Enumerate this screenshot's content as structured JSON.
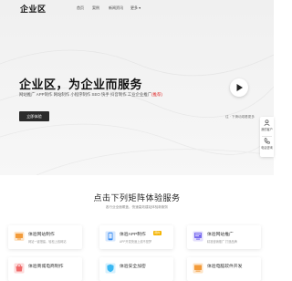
{
  "header": {
    "logo": "企业区",
    "nav": [
      "首页",
      "案例",
      "新闻资讯",
      "更多 ▾"
    ]
  },
  "hero": {
    "title": "企业区，为企业而服务",
    "subtitle_main": "网站推广 APP制作 网站制作 小程序制作 SEO 快手 抖音制作 工业企业推广",
    "subtitle_highlight": "(推荐)",
    "button": "立即体验",
    "hint": "往 · 下滑动观看更多"
  },
  "float_panel": {
    "items": [
      {
        "icon": "user-icon",
        "label": "我的客户"
      },
      {
        "icon": "phone-icon",
        "label": "电话咨询"
      }
    ]
  },
  "services": {
    "title": "点击下列矩阵体验服务",
    "subtitle": "各行业全面覆盖，快速高效建站体验新服务",
    "cards": [
      {
        "icon": "website-icon",
        "title": "体验网站制作",
        "desc": "网站一键搭建，轻松上线网站",
        "badge": "",
        "color": "#f39b3a"
      },
      {
        "icon": "app-icon",
        "title": "体验APP制作",
        "desc": "APP开发快速上线不是梦",
        "badge": "限时",
        "color": "#3a8ef3"
      },
      {
        "icon": "promotion-icon",
        "title": "体验网站推广",
        "desc": "精准营销推广 打造品牌",
        "badge": "",
        "color": "#7a6cf0"
      },
      {
        "icon": "mall-icon",
        "title": "体验商城电商制作",
        "desc": "",
        "badge": "",
        "color": "#f06a6a"
      },
      {
        "icon": "security-icon",
        "title": "体验安全加密",
        "desc": "",
        "badge": "",
        "color": "#3ab8f3"
      },
      {
        "icon": "ecommerce-icon",
        "title": "体验电脑软件开发",
        "desc": "",
        "badge": "",
        "color": "#f39b3a"
      }
    ]
  }
}
